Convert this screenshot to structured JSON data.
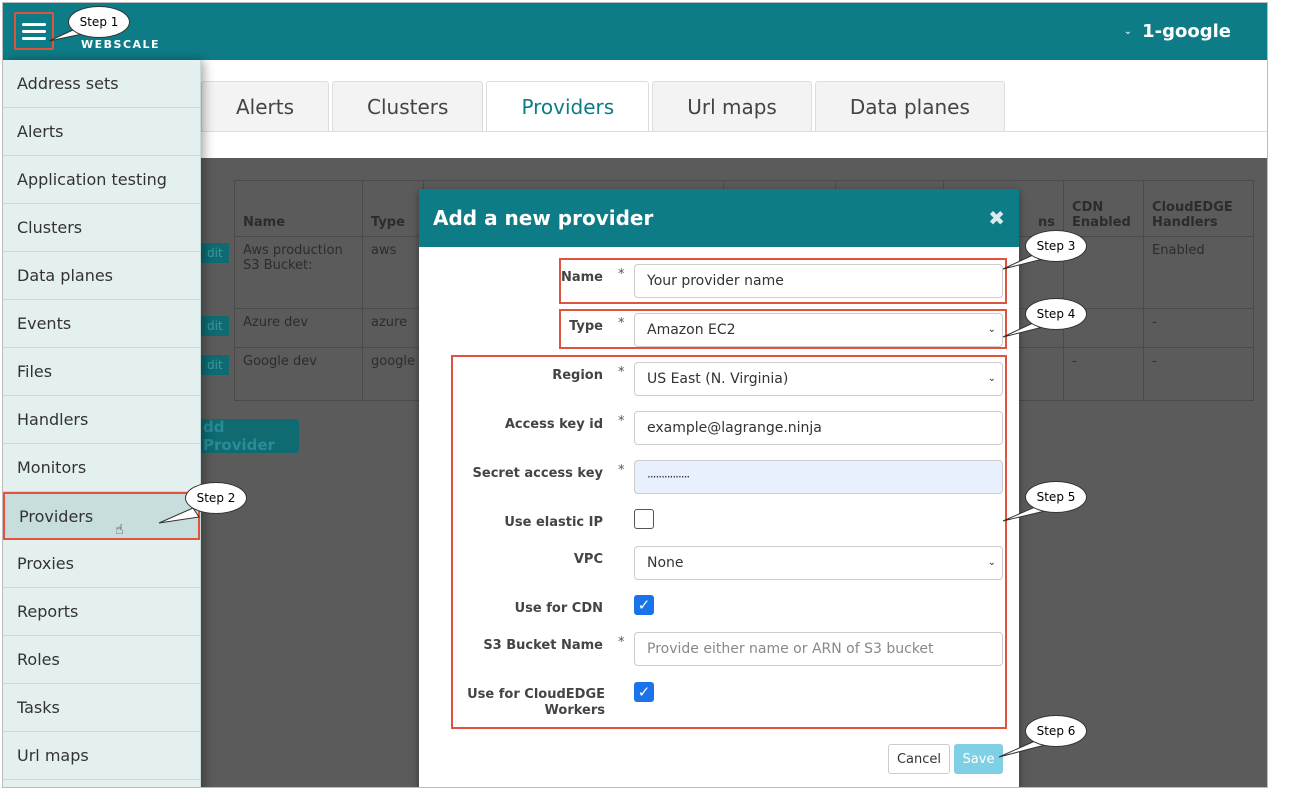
{
  "header": {
    "logo_text": "WEBSCALE",
    "account": "1-google",
    "brand_color": "#0e7c86"
  },
  "tabs": [
    {
      "label": "Alerts"
    },
    {
      "label": "Clusters"
    },
    {
      "label": "Providers",
      "active": true
    },
    {
      "label": "Url maps"
    },
    {
      "label": "Data planes"
    }
  ],
  "sidebar": {
    "items": [
      {
        "label": "Address sets"
      },
      {
        "label": "Alerts"
      },
      {
        "label": "Application testing"
      },
      {
        "label": "Clusters"
      },
      {
        "label": "Data planes"
      },
      {
        "label": "Events"
      },
      {
        "label": "Files"
      },
      {
        "label": "Handlers"
      },
      {
        "label": "Monitors"
      },
      {
        "label": "Providers",
        "active": true
      },
      {
        "label": "Proxies"
      },
      {
        "label": "Reports"
      },
      {
        "label": "Roles"
      },
      {
        "label": "Tasks"
      },
      {
        "label": "Url maps"
      }
    ]
  },
  "table": {
    "headers": [
      "Name",
      "Type",
      "CDN Enabled",
      "CloudEDGE Handlers"
    ],
    "header_partial": "ns",
    "rows": [
      {
        "name": "Aws production S3 Bucket:",
        "type": "aws",
        "cdn": "",
        "cloudedge": "Enabled",
        "edit": "dit"
      },
      {
        "name": "Azure dev",
        "type": "azure",
        "cdn": "",
        "cloudedge": "-",
        "edit": "dit"
      },
      {
        "name": "Google dev",
        "type": "google",
        "cdn": "-",
        "cloudedge": "-",
        "edit": "dit"
      }
    ],
    "add_button": "dd Provider"
  },
  "modal": {
    "title": "Add a new provider",
    "close": "✖",
    "fields": {
      "name": {
        "label": "Name",
        "value": "Your provider name",
        "required": "*"
      },
      "type": {
        "label": "Type",
        "value": "Amazon EC2",
        "required": "*"
      },
      "region": {
        "label": "Region",
        "value": "US East (N. Virginia)",
        "required": "*"
      },
      "access_key": {
        "label": "Access key id",
        "value": "example@lagrange.ninja",
        "required": "*"
      },
      "secret_key": {
        "label": "Secret access key",
        "value": "···············",
        "required": "*"
      },
      "elastic_ip": {
        "label": "Use elastic IP",
        "checked": false
      },
      "vpc": {
        "label": "VPC",
        "value": "None"
      },
      "cdn": {
        "label": "Use for CDN",
        "checked": true
      },
      "s3_bucket": {
        "label": "S3 Bucket Name",
        "placeholder": "Provide either name or ARN of S3 bucket",
        "required": "*"
      },
      "cloudedge": {
        "label": "Use for CloudEDGE Workers",
        "checked": true
      }
    },
    "cancel": "Cancel",
    "save": "Save"
  },
  "callouts": {
    "step1": "Step 1",
    "step2": "Step 2",
    "step3": "Step 3",
    "step4": "Step 4",
    "step5": "Step 5",
    "step6": "Step 6"
  },
  "colors": {
    "highlight": "#e0533f",
    "checkbox": "#1a73e8",
    "save_button": "#7fd0e4"
  }
}
